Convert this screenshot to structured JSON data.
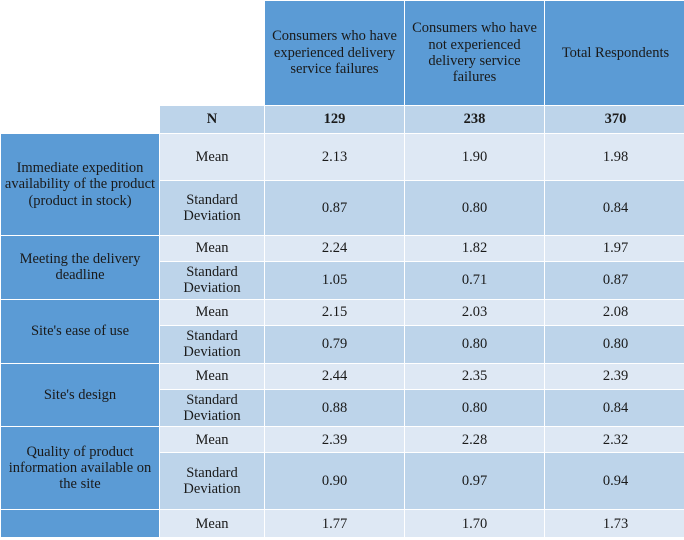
{
  "table": {
    "column_headers": [
      "",
      "",
      "Consumers who have experienced delivery service failures",
      "Consumers who have not experienced delivery service failures",
      "Total Respondents"
    ],
    "n_row": {
      "label": "N",
      "experienced": "129",
      "not_experienced": "238",
      "total": "370"
    },
    "stat_labels": {
      "mean": "Mean",
      "sd": "Standard Deviation"
    },
    "rows": [
      {
        "attribute": "Immediate expedition availability of the product (product in stock)",
        "mean": {
          "experienced": "2.13",
          "not_experienced": "1.90",
          "total": "1.98"
        },
        "sd": {
          "experienced": "0.87",
          "not_experienced": "0.80",
          "total": "0.84"
        }
      },
      {
        "attribute": "Meeting the delivery deadline",
        "mean": {
          "experienced": "2.24",
          "not_experienced": "1.82",
          "total": "1.97"
        },
        "sd": {
          "experienced": "1.05",
          "not_experienced": "0.71",
          "total": "0.87"
        }
      },
      {
        "attribute": "Site's ease of use",
        "mean": {
          "experienced": "2.15",
          "not_experienced": "2.03",
          "total": "2.08"
        },
        "sd": {
          "experienced": "0.79",
          "not_experienced": "0.80",
          "total": "0.80"
        }
      },
      {
        "attribute": "Site's design",
        "mean": {
          "experienced": "2.44",
          "not_experienced": "2.35",
          "total": "2.39"
        },
        "sd": {
          "experienced": "0.88",
          "not_experienced": "0.80",
          "total": "0.84"
        }
      },
      {
        "attribute": "Quality of product information available on the site",
        "mean": {
          "experienced": "2.39",
          "not_experienced": "2.28",
          "total": "2.32"
        },
        "sd": {
          "experienced": "0.90",
          "not_experienced": "0.97",
          "total": "0.94"
        }
      },
      {
        "attribute": "",
        "mean": {
          "experienced": "1.77",
          "not_experienced": "1.70",
          "total": "1.73"
        },
        "sd": {
          "experienced": "",
          "not_experienced": "",
          "total": ""
        }
      }
    ]
  },
  "colors": {
    "header_blue": "#5B9BD5",
    "row_light": "#DEE8F4",
    "row_medium": "#BDD4EA",
    "page_background": "#FFFFFF",
    "text": "#1A1A1A"
  }
}
